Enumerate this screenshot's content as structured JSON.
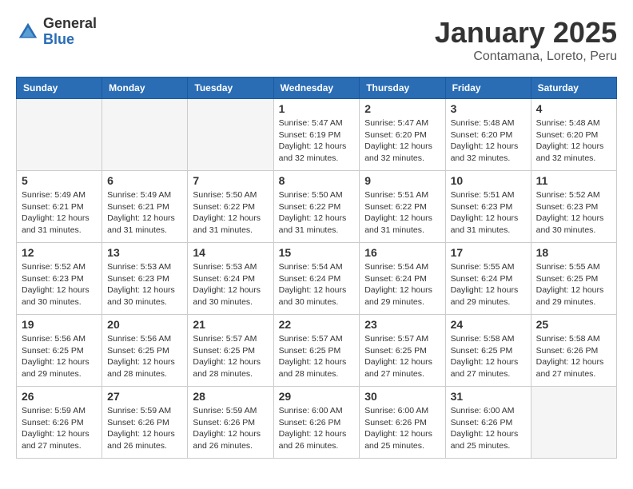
{
  "header": {
    "logo_general": "General",
    "logo_blue": "Blue",
    "month_title": "January 2025",
    "location": "Contamana, Loreto, Peru"
  },
  "days_of_week": [
    "Sunday",
    "Monday",
    "Tuesday",
    "Wednesday",
    "Thursday",
    "Friday",
    "Saturday"
  ],
  "weeks": [
    [
      {
        "day": "",
        "info": ""
      },
      {
        "day": "",
        "info": ""
      },
      {
        "day": "",
        "info": ""
      },
      {
        "day": "1",
        "info": "Sunrise: 5:47 AM\nSunset: 6:19 PM\nDaylight: 12 hours\nand 32 minutes."
      },
      {
        "day": "2",
        "info": "Sunrise: 5:47 AM\nSunset: 6:20 PM\nDaylight: 12 hours\nand 32 minutes."
      },
      {
        "day": "3",
        "info": "Sunrise: 5:48 AM\nSunset: 6:20 PM\nDaylight: 12 hours\nand 32 minutes."
      },
      {
        "day": "4",
        "info": "Sunrise: 5:48 AM\nSunset: 6:20 PM\nDaylight: 12 hours\nand 32 minutes."
      }
    ],
    [
      {
        "day": "5",
        "info": "Sunrise: 5:49 AM\nSunset: 6:21 PM\nDaylight: 12 hours\nand 31 minutes."
      },
      {
        "day": "6",
        "info": "Sunrise: 5:49 AM\nSunset: 6:21 PM\nDaylight: 12 hours\nand 31 minutes."
      },
      {
        "day": "7",
        "info": "Sunrise: 5:50 AM\nSunset: 6:22 PM\nDaylight: 12 hours\nand 31 minutes."
      },
      {
        "day": "8",
        "info": "Sunrise: 5:50 AM\nSunset: 6:22 PM\nDaylight: 12 hours\nand 31 minutes."
      },
      {
        "day": "9",
        "info": "Sunrise: 5:51 AM\nSunset: 6:22 PM\nDaylight: 12 hours\nand 31 minutes."
      },
      {
        "day": "10",
        "info": "Sunrise: 5:51 AM\nSunset: 6:23 PM\nDaylight: 12 hours\nand 31 minutes."
      },
      {
        "day": "11",
        "info": "Sunrise: 5:52 AM\nSunset: 6:23 PM\nDaylight: 12 hours\nand 30 minutes."
      }
    ],
    [
      {
        "day": "12",
        "info": "Sunrise: 5:52 AM\nSunset: 6:23 PM\nDaylight: 12 hours\nand 30 minutes."
      },
      {
        "day": "13",
        "info": "Sunrise: 5:53 AM\nSunset: 6:23 PM\nDaylight: 12 hours\nand 30 minutes."
      },
      {
        "day": "14",
        "info": "Sunrise: 5:53 AM\nSunset: 6:24 PM\nDaylight: 12 hours\nand 30 minutes."
      },
      {
        "day": "15",
        "info": "Sunrise: 5:54 AM\nSunset: 6:24 PM\nDaylight: 12 hours\nand 30 minutes."
      },
      {
        "day": "16",
        "info": "Sunrise: 5:54 AM\nSunset: 6:24 PM\nDaylight: 12 hours\nand 29 minutes."
      },
      {
        "day": "17",
        "info": "Sunrise: 5:55 AM\nSunset: 6:24 PM\nDaylight: 12 hours\nand 29 minutes."
      },
      {
        "day": "18",
        "info": "Sunrise: 5:55 AM\nSunset: 6:25 PM\nDaylight: 12 hours\nand 29 minutes."
      }
    ],
    [
      {
        "day": "19",
        "info": "Sunrise: 5:56 AM\nSunset: 6:25 PM\nDaylight: 12 hours\nand 29 minutes."
      },
      {
        "day": "20",
        "info": "Sunrise: 5:56 AM\nSunset: 6:25 PM\nDaylight: 12 hours\nand 28 minutes."
      },
      {
        "day": "21",
        "info": "Sunrise: 5:57 AM\nSunset: 6:25 PM\nDaylight: 12 hours\nand 28 minutes."
      },
      {
        "day": "22",
        "info": "Sunrise: 5:57 AM\nSunset: 6:25 PM\nDaylight: 12 hours\nand 28 minutes."
      },
      {
        "day": "23",
        "info": "Sunrise: 5:57 AM\nSunset: 6:25 PM\nDaylight: 12 hours\nand 27 minutes."
      },
      {
        "day": "24",
        "info": "Sunrise: 5:58 AM\nSunset: 6:25 PM\nDaylight: 12 hours\nand 27 minutes."
      },
      {
        "day": "25",
        "info": "Sunrise: 5:58 AM\nSunset: 6:26 PM\nDaylight: 12 hours\nand 27 minutes."
      }
    ],
    [
      {
        "day": "26",
        "info": "Sunrise: 5:59 AM\nSunset: 6:26 PM\nDaylight: 12 hours\nand 27 minutes."
      },
      {
        "day": "27",
        "info": "Sunrise: 5:59 AM\nSunset: 6:26 PM\nDaylight: 12 hours\nand 26 minutes."
      },
      {
        "day": "28",
        "info": "Sunrise: 5:59 AM\nSunset: 6:26 PM\nDaylight: 12 hours\nand 26 minutes."
      },
      {
        "day": "29",
        "info": "Sunrise: 6:00 AM\nSunset: 6:26 PM\nDaylight: 12 hours\nand 26 minutes."
      },
      {
        "day": "30",
        "info": "Sunrise: 6:00 AM\nSunset: 6:26 PM\nDaylight: 12 hours\nand 25 minutes."
      },
      {
        "day": "31",
        "info": "Sunrise: 6:00 AM\nSunset: 6:26 PM\nDaylight: 12 hours\nand 25 minutes."
      },
      {
        "day": "",
        "info": ""
      }
    ]
  ]
}
